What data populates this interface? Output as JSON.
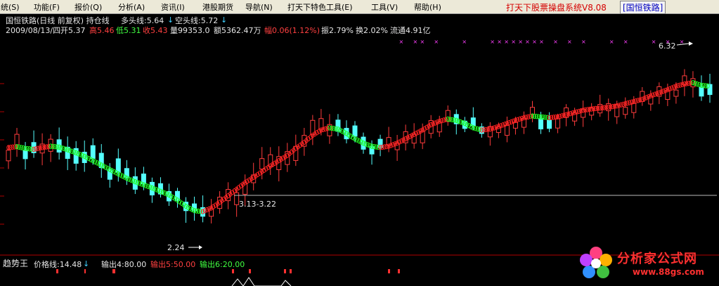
{
  "menu": {
    "items": [
      "统(S)",
      "功能(F)",
      "报价(Q)",
      "分析(A)",
      "资讯(I)",
      "港股期货",
      "导航(N)",
      "打天下特色工具(E)",
      "工具(V)",
      "帮助(H)"
    ],
    "app_title": "打天下股票操盘系统V8.08",
    "stock_tag": "[国恒铁路]"
  },
  "header": {
    "line1_name": "国恒铁路(日线 前复权) 持仓线",
    "line1_duo": "多头线:5.64",
    "line1_kong": "空头线:5.72",
    "line2_date": "2009/08/13/四",
    "line2_open": "开5.37",
    "line2_high": "高5.46",
    "line2_low": "低5.31",
    "line2_close": "收5.43",
    "line2_vol": "量99353.0",
    "line2_amt": "额5362.47万",
    "line2_chg": "幅0.06(1.12%)",
    "line2_amp": "振2.79%",
    "line2_turn": "换2.02%",
    "line2_float": "流通4.91亿"
  },
  "annotations": {
    "low_label": "2.24",
    "range_label": "3.13-3.22",
    "high_label": "6.32"
  },
  "subpanel": {
    "name": "趋势王",
    "price_line": "价格线:14.48",
    "out4": "输出4:80.00",
    "out5": "输出5:50.00",
    "out6": "输出6:20.00"
  },
  "logo": {
    "name": "分析家公式网",
    "url": "www.88gs.com"
  },
  "chart_data": {
    "type": "candlestick",
    "series": [
      {
        "name": "持仓线",
        "values": [
          4.3,
          4.32,
          4.28,
          4.26,
          4.3,
          4.33,
          4.31,
          4.25,
          4.18,
          4.1,
          4.0,
          3.9,
          3.8,
          3.7,
          3.6,
          3.52,
          3.45,
          3.38,
          3.3,
          3.22,
          3.1,
          2.96,
          2.86,
          2.84,
          2.92,
          3.05,
          3.2,
          3.35,
          3.5,
          3.62,
          3.75,
          3.88,
          4.0,
          4.12,
          4.28,
          4.42,
          4.58,
          4.7,
          4.75,
          4.72,
          4.62,
          4.5,
          4.4,
          4.33,
          4.3,
          4.33,
          4.4,
          4.5,
          4.6,
          4.7,
          4.82,
          4.9,
          4.95,
          4.92,
          4.85,
          4.75,
          4.7,
          4.72,
          4.78,
          4.85,
          4.92,
          4.98,
          5.02,
          5.0,
          4.98,
          5.0,
          5.05,
          5.1,
          5.15,
          5.18,
          5.2,
          5.22,
          5.25,
          5.3,
          5.35,
          5.4,
          5.48,
          5.55,
          5.62,
          5.7,
          5.75,
          5.78,
          5.72,
          5.7
        ]
      }
    ],
    "annotations": [
      "2.24",
      "3.13-3.22",
      "6.32"
    ]
  }
}
